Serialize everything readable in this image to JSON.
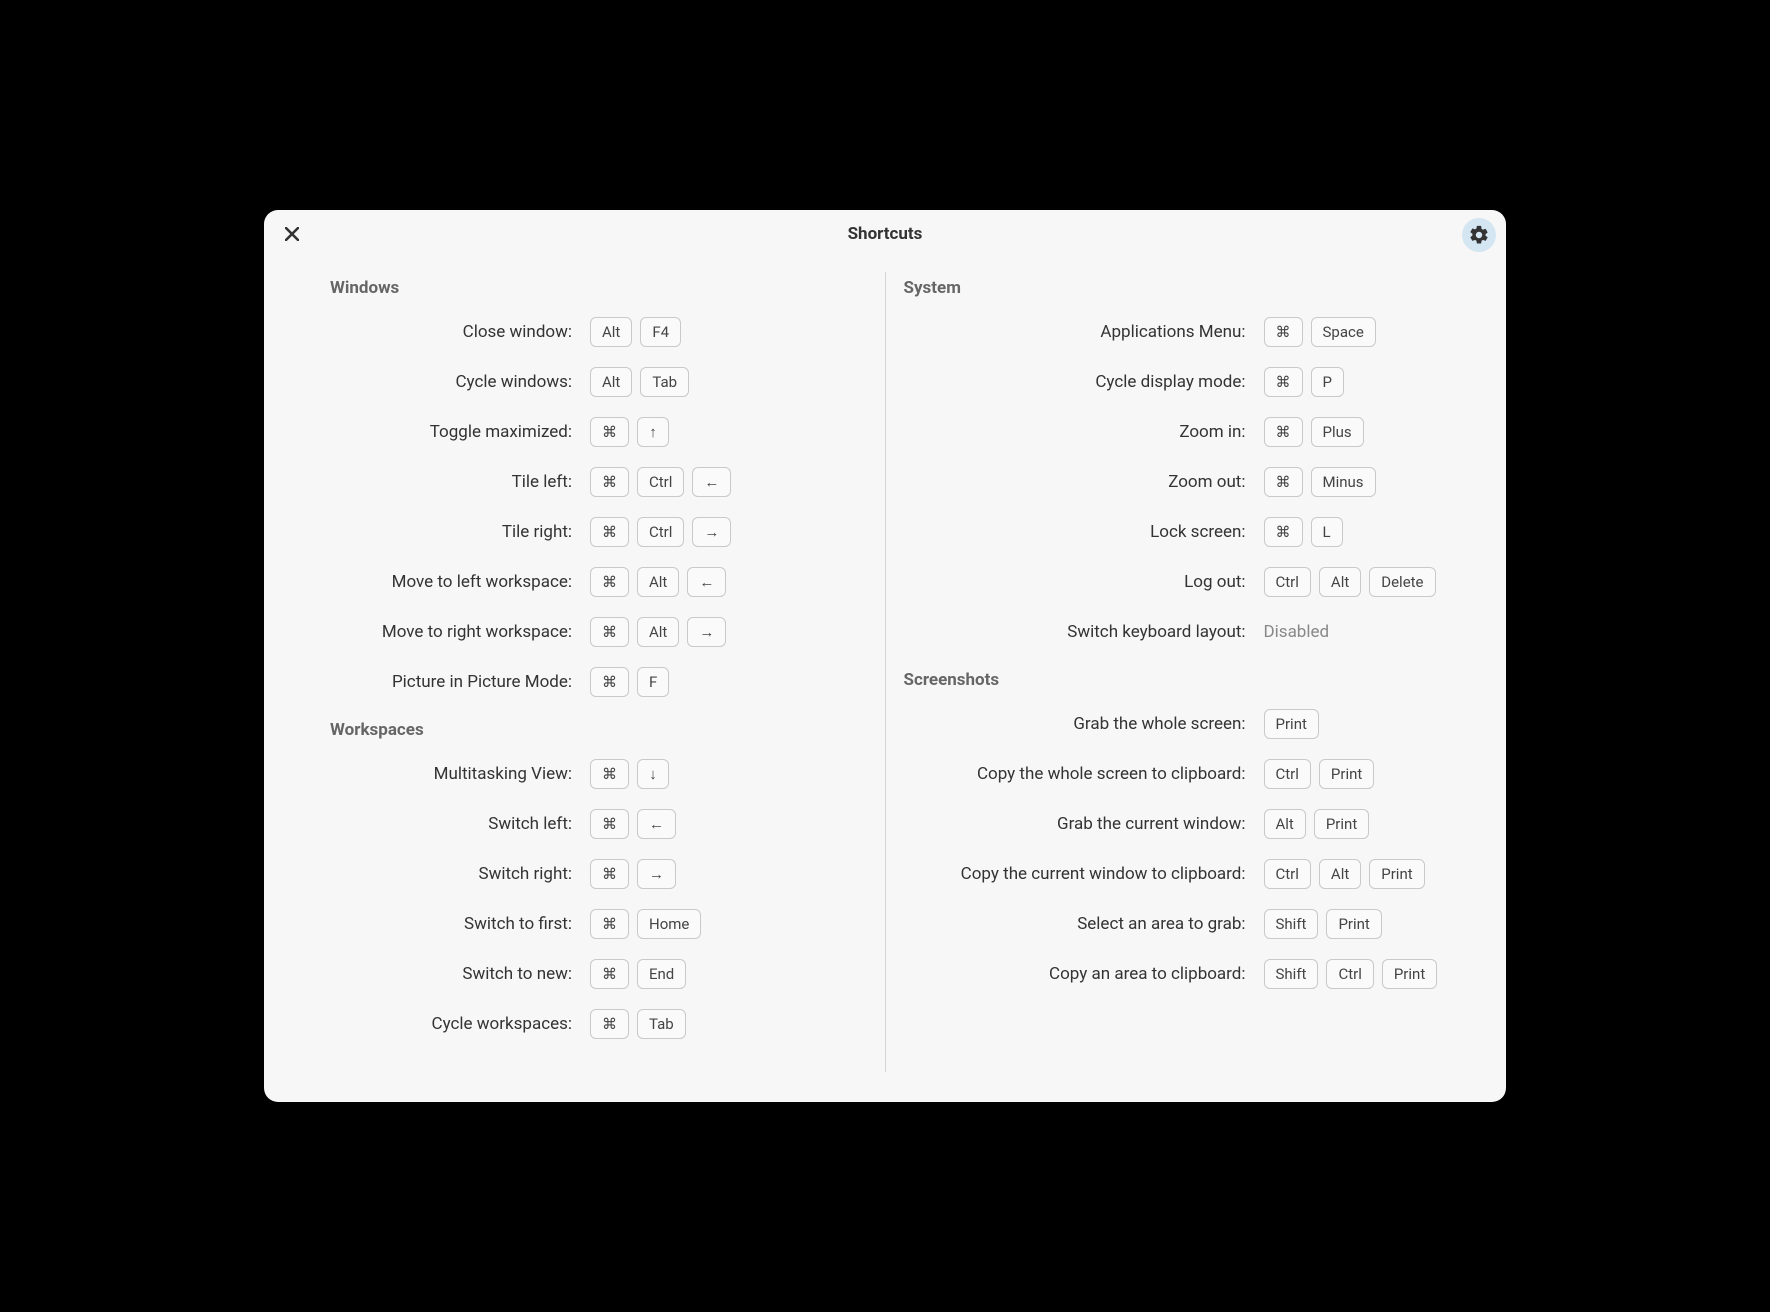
{
  "title": "Shortcuts",
  "glyph": {
    "cmd": "⌘",
    "up": "↑",
    "down": "↓",
    "left": "←",
    "right": "→"
  },
  "left": {
    "sections": [
      {
        "title": "Windows",
        "items": [
          {
            "label": "Close window:",
            "keys": [
              "Alt",
              "F4"
            ]
          },
          {
            "label": "Cycle windows:",
            "keys": [
              "Alt",
              "Tab"
            ]
          },
          {
            "label": "Toggle maximized:",
            "keys": [
              "⌘",
              "↑"
            ]
          },
          {
            "label": "Tile left:",
            "keys": [
              "⌘",
              "Ctrl",
              "←"
            ]
          },
          {
            "label": "Tile right:",
            "keys": [
              "⌘",
              "Ctrl",
              "→"
            ]
          },
          {
            "label": "Move to left workspace:",
            "keys": [
              "⌘",
              "Alt",
              "←"
            ]
          },
          {
            "label": "Move to right workspace:",
            "keys": [
              "⌘",
              "Alt",
              "→"
            ]
          },
          {
            "label": "Picture in Picture Mode:",
            "keys": [
              "⌘",
              "F"
            ]
          }
        ]
      },
      {
        "title": "Workspaces",
        "items": [
          {
            "label": "Multitasking View:",
            "keys": [
              "⌘",
              "↓"
            ]
          },
          {
            "label": "Switch left:",
            "keys": [
              "⌘",
              "←"
            ]
          },
          {
            "label": "Switch right:",
            "keys": [
              "⌘",
              "→"
            ]
          },
          {
            "label": "Switch to first:",
            "keys": [
              "⌘",
              "Home"
            ]
          },
          {
            "label": "Switch to new:",
            "keys": [
              "⌘",
              "End"
            ]
          },
          {
            "label": "Cycle workspaces:",
            "keys": [
              "⌘",
              "Tab"
            ]
          }
        ]
      }
    ]
  },
  "right": {
    "sections": [
      {
        "title": "System",
        "items": [
          {
            "label": "Applications Menu:",
            "keys": [
              "⌘",
              "Space"
            ]
          },
          {
            "label": "Cycle display mode:",
            "keys": [
              "⌘",
              "P"
            ]
          },
          {
            "label": "Zoom in:",
            "keys": [
              "⌘",
              "Plus"
            ]
          },
          {
            "label": "Zoom out:",
            "keys": [
              "⌘",
              "Minus"
            ]
          },
          {
            "label": "Lock screen:",
            "keys": [
              "⌘",
              "L"
            ]
          },
          {
            "label": "Log out:",
            "keys": [
              "Ctrl",
              "Alt",
              "Delete"
            ]
          },
          {
            "label": "Switch keyboard layout:",
            "disabled": "Disabled"
          }
        ]
      },
      {
        "title": "Screenshots",
        "items": [
          {
            "label": "Grab the whole screen:",
            "keys": [
              "Print"
            ]
          },
          {
            "label": "Copy the whole screen to clipboard:",
            "keys": [
              "Ctrl",
              "Print"
            ]
          },
          {
            "label": "Grab the current window:",
            "keys": [
              "Alt",
              "Print"
            ]
          },
          {
            "label": "Copy the current window to clipboard:",
            "keys": [
              "Ctrl",
              "Alt",
              "Print"
            ]
          },
          {
            "label": "Select an area to grab:",
            "keys": [
              "Shift",
              "Print"
            ]
          },
          {
            "label": "Copy an area to clipboard:",
            "keys": [
              "Shift",
              "Ctrl",
              "Print"
            ]
          }
        ]
      }
    ]
  }
}
